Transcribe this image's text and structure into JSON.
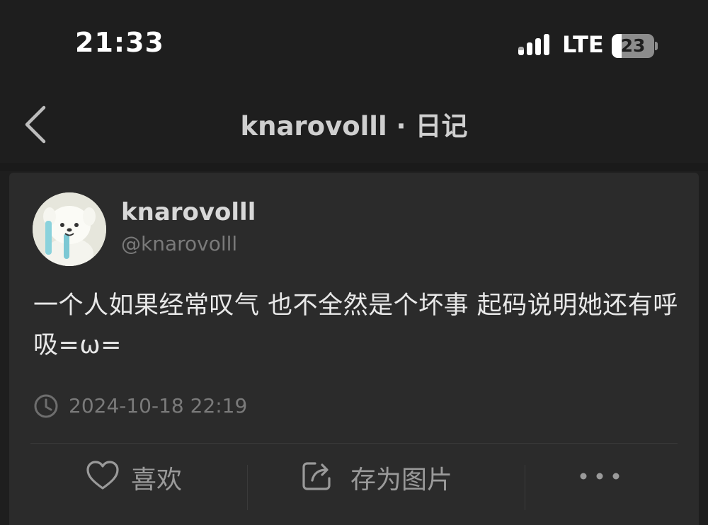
{
  "status_bar": {
    "time": "21:33",
    "network": "LTE",
    "battery_level": "23",
    "icons": [
      "signal-icon",
      "battery-icon"
    ]
  },
  "nav": {
    "title": "knarovolll · 日记",
    "back_icon": "chevron-left-icon"
  },
  "post": {
    "author_name": "knarovolll",
    "author_handle": "@knarovolll",
    "content": "一个人如果经常叹气 也不全然是个坏事 起码说明她还有呼吸=ω=",
    "timestamp": "2024-10-18 22:19"
  },
  "actions": {
    "like_label": "喜欢",
    "save_image_label": "存为图片",
    "icons": [
      "heart-icon",
      "share-export-icon",
      "more-icon"
    ]
  },
  "colors": {
    "background": "#1e1e1e",
    "card": "#2b2b2b",
    "primary_text": "#e8e8e8",
    "secondary_text": "#7a7a7a"
  }
}
